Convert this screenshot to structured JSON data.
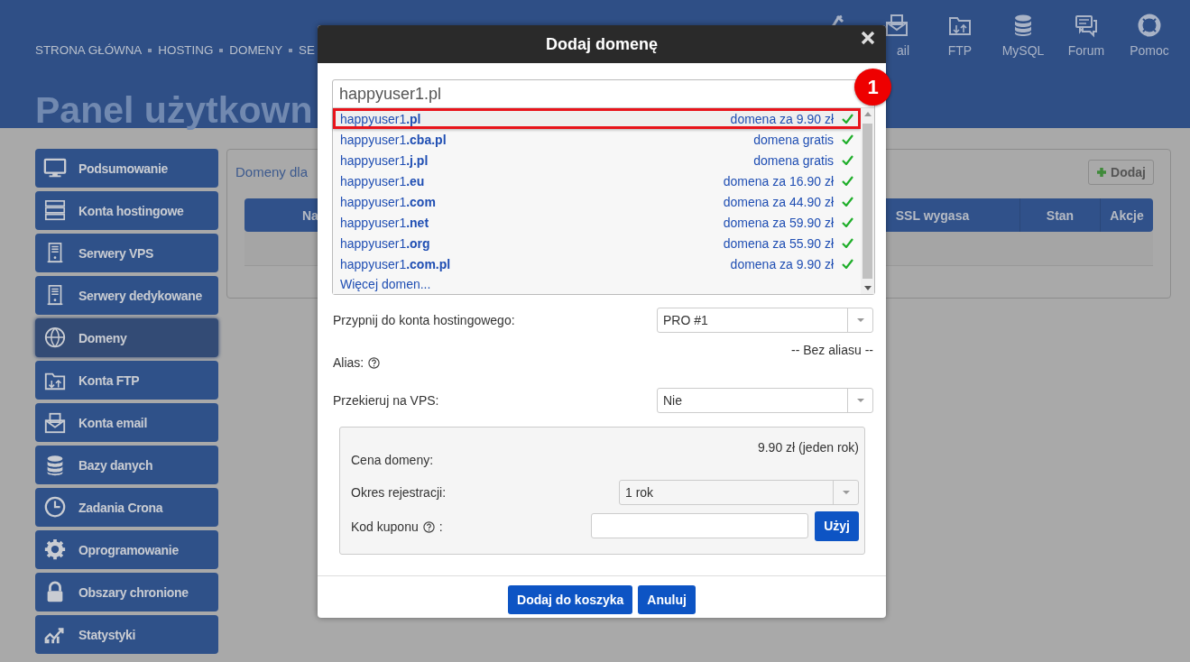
{
  "header": {
    "nav": [
      "STRONA GŁÓWNA",
      "HOSTING",
      "DOMENY",
      "SE"
    ],
    "tools": [
      {
        "kind": "wrench"
      },
      {
        "kind": "mail",
        "label": "ail"
      },
      {
        "kind": "ftp",
        "label": "FTP"
      },
      {
        "kind": "database",
        "label": "MySQL"
      },
      {
        "kind": "forum",
        "label": "Forum"
      },
      {
        "kind": "help",
        "label": "Pomoc"
      }
    ],
    "title": "Panel użytkown"
  },
  "sidebar": {
    "items": [
      {
        "kind": "monitor",
        "label": "Podsumowanie",
        "selected": false
      },
      {
        "kind": "servers",
        "label": "Konta hostingowe",
        "selected": false
      },
      {
        "kind": "tower",
        "label": "Serwery VPS",
        "selected": false
      },
      {
        "kind": "tower",
        "label": "Serwery dedykowane",
        "selected": false
      },
      {
        "kind": "globe",
        "label": "Domeny",
        "selected": true
      },
      {
        "kind": "ftp",
        "label": "Konta FTP",
        "selected": false
      },
      {
        "kind": "mail",
        "label": "Konta email",
        "selected": false
      },
      {
        "kind": "database",
        "label": "Bazy danych",
        "selected": false
      },
      {
        "kind": "clock",
        "label": "Zadania Crona",
        "selected": false
      },
      {
        "kind": "gear",
        "label": "Oprogramowanie",
        "selected": false
      },
      {
        "kind": "lock",
        "label": "Obszary chronione",
        "selected": false
      },
      {
        "kind": "chart",
        "label": "Statystyki",
        "selected": false
      }
    ]
  },
  "content": {
    "heading": "Domeny dla",
    "add_button": "Dodaj",
    "table": {
      "columns": [
        "Na",
        "SSL wygasa",
        "Stan",
        "Akcje"
      ]
    }
  },
  "dialog": {
    "title": "Dodaj domenę",
    "search": {
      "value": "happyuser1.pl"
    },
    "suggestions": [
      {
        "name": "happyuser1**.pl**",
        "price": "domena za 9.90 zł",
        "available": true,
        "selected": true
      },
      {
        "name": "happyuser1**.cba.pl**",
        "price": "domena gratis",
        "available": true,
        "selected": false
      },
      {
        "name": "happyuser1**.j.pl**",
        "price": "domena gratis",
        "available": true,
        "selected": false
      },
      {
        "name": "happyuser1**.eu**",
        "price": "domena za 16.90 zł",
        "available": true,
        "selected": false
      },
      {
        "name": "happyuser1**.com**",
        "price": "domena za 44.90 zł",
        "available": true,
        "selected": false
      },
      {
        "name": "happyuser1**.net**",
        "price": "domena za 59.90 zł",
        "available": true,
        "selected": false
      },
      {
        "name": "happyuser1**.org**",
        "price": "domena za 55.90 zł",
        "available": true,
        "selected": false
      },
      {
        "name": "happyuser1**.com.pl**",
        "price": "domena za 9.90 zł",
        "available": true,
        "selected": false
      }
    ],
    "more": "Więcej domen...",
    "fields": [
      {
        "kind": "select",
        "label": "Przypnij do konta hostingowego:",
        "value": "PRO #1"
      },
      {
        "kind": "text",
        "label": "Alias:",
        "help": true,
        "value": "-- Bez aliasu --"
      },
      {
        "kind": "select",
        "label": "Przekieruj na VPS:",
        "value": "Nie"
      }
    ],
    "pricing": [
      {
        "kind": "text",
        "label": "Cena domeny:",
        "value": "9.90 zł (jeden rok)"
      },
      {
        "kind": "select",
        "label": "Okres rejestracji:",
        "value": "1 rok"
      },
      {
        "kind": "coupon",
        "label": "Kod kuponu",
        "help": true,
        "suffix": ":",
        "button": "Użyj"
      }
    ],
    "buttons": [
      "Dodaj do koszyka",
      "Anuluj"
    ]
  },
  "callout": {
    "number": "1"
  }
}
